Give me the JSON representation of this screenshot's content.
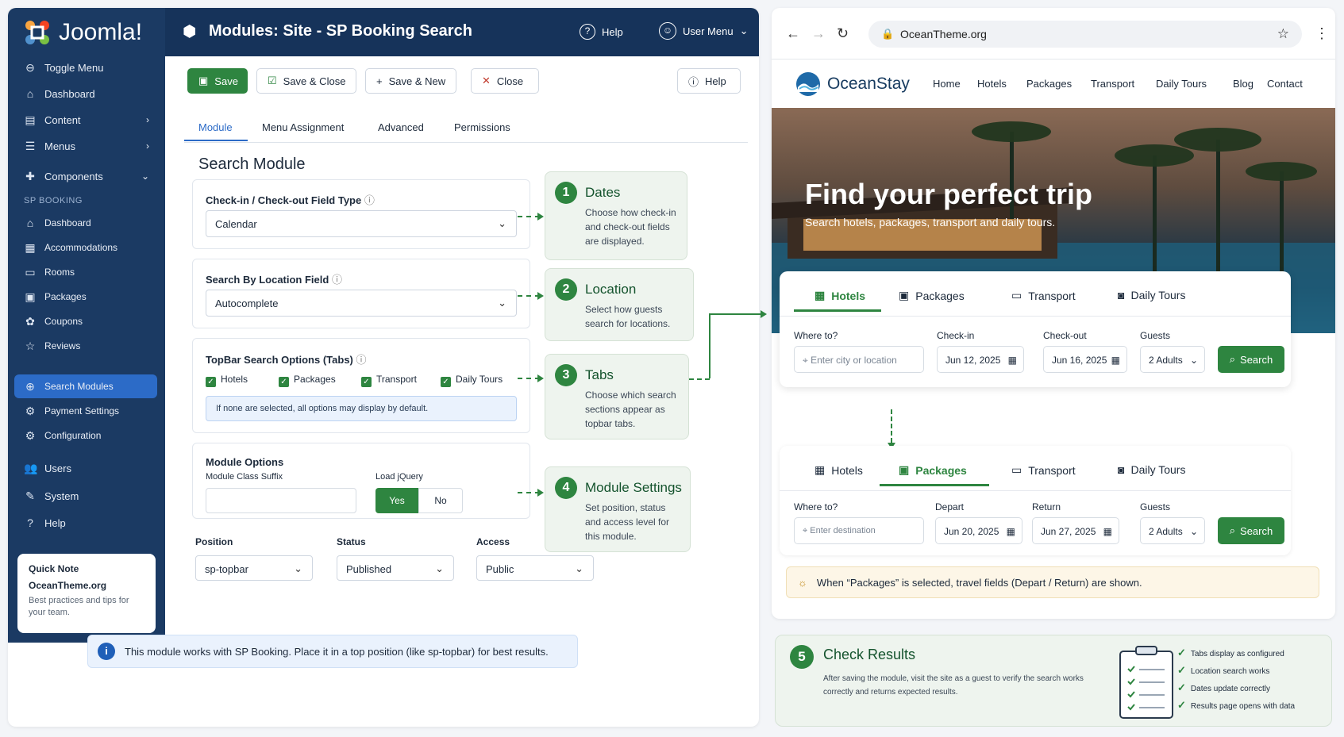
{
  "sidebar": {
    "brand": "Joomla!",
    "items": [
      {
        "label": "Toggle Menu",
        "icon": "toggle-icon"
      },
      {
        "label": "Dashboard",
        "icon": "home-icon"
      },
      {
        "label": "Content",
        "icon": "content-icon"
      },
      {
        "label": "Menus",
        "icon": "menu-icon"
      },
      {
        "label": "Components",
        "icon": "puzzle-icon"
      }
    ],
    "section_title": "SP BOOKING",
    "sp_items": [
      {
        "label": "Dashboard"
      },
      {
        "label": "Accommodations"
      },
      {
        "label": "Rooms"
      },
      {
        "label": "Packages"
      },
      {
        "label": "Coupons"
      },
      {
        "label": "Reviews"
      },
      {
        "label": "Search Modules"
      },
      {
        "label": "Payment Settings"
      },
      {
        "label": "Configuration"
      }
    ],
    "bottom_items": [
      {
        "label": "Users"
      },
      {
        "label": "System"
      },
      {
        "label": "Help"
      }
    ],
    "quick_note": {
      "title": "Quick Note",
      "site": "OceanTheme.org",
      "text": "Best practices and tips for your team."
    }
  },
  "header": {
    "title": "Modules: Site - SP Booking Search",
    "help": "Help",
    "user_menu": "User Menu"
  },
  "toolbar": {
    "save": "Save",
    "save_close": "Save & Close",
    "save_new": "Save & New",
    "close": "Close",
    "help": "Help"
  },
  "tabs": [
    "Module",
    "Menu Assignment",
    "Advanced",
    "Permissions"
  ],
  "form": {
    "heading": "Search Module",
    "checkin_label": "Check-in / Check-out Field Type",
    "checkin_value": "Calendar",
    "location_label": "Search By Location Field",
    "location_value": "Autocomplete",
    "topbar_label": "TopBar Search Options (Tabs)",
    "topbar_options": [
      "Hotels",
      "Packages",
      "Transport",
      "Daily Tours"
    ],
    "topbar_note": "If none are selected, all options may display by default.",
    "module_options": "Module Options",
    "class_suffix": "Module Class Suffix",
    "load_jquery": "Load jQuery",
    "yes": "Yes",
    "no": "No",
    "position_label": "Position",
    "position_value": "sp-topbar",
    "status_label": "Status",
    "status_value": "Published",
    "access_label": "Access",
    "access_value": "Public",
    "info": "This module works with SP Booking. Place it in a top position (like sp-topbar) for best results."
  },
  "steps": [
    {
      "num": "1",
      "title": "Dates",
      "text": "Choose how check-in and check-out fields are displayed."
    },
    {
      "num": "2",
      "title": "Location",
      "text": "Select how guests search for locations."
    },
    {
      "num": "3",
      "title": "Tabs",
      "text": "Choose which search sections appear as topbar tabs."
    },
    {
      "num": "4",
      "title": "Module Settings",
      "text": "Set position, status and access level for this module."
    }
  ],
  "browser": {
    "url": "OceanTheme.org",
    "site_name": "OceanStay",
    "nav": [
      "Home",
      "Hotels",
      "Packages",
      "Transport",
      "Daily Tours",
      "Blog",
      "Contact"
    ],
    "hero_title": "Find your perfect trip",
    "hero_sub": "Search hotels, packages, transport and daily tours.",
    "search_tabs": [
      "Hotels",
      "Packages",
      "Transport",
      "Daily Tours"
    ],
    "card1": {
      "where_label": "Where to?",
      "where_placeholder": "Enter city or location",
      "in_label": "Check-in",
      "in_value": "Jun 12, 2025",
      "out_label": "Check-out",
      "out_value": "Jun 16, 2025",
      "guests_label": "Guests",
      "guests_value": "2 Adults",
      "search": "Search"
    },
    "card2": {
      "where_label": "Where to?",
      "where_placeholder": "Enter destination",
      "in_label": "Depart",
      "in_value": "Jun 20, 2025",
      "out_label": "Return",
      "out_value": "Jun 27, 2025",
      "guests_label": "Guests",
      "guests_value": "2 Adults",
      "search": "Search"
    },
    "packages_note": "When “Packages” is selected, travel fields (Depart / Return) are shown."
  },
  "result": {
    "num": "5",
    "title": "Check Results",
    "text": "After saving the module, visit the site as a guest to verify the search works correctly and returns expected results.",
    "checks": [
      "Tabs display as configured",
      "Location search works",
      "Dates update correctly",
      "Results page opens with data"
    ]
  },
  "colors": {
    "accent": "#2e8540",
    "sidebar": "#1b3a63",
    "header": "#16335a",
    "active": "#2c6bc7"
  }
}
